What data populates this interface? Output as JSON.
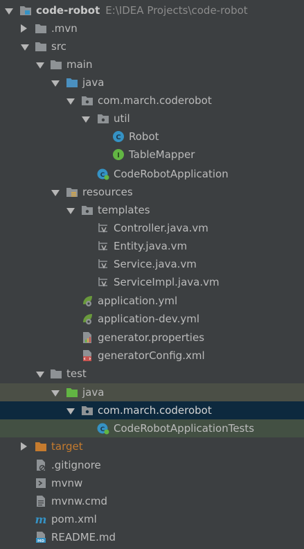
{
  "project": {
    "name": "code-robot",
    "path": "E:\\IDEA Projects\\code-robot"
  },
  "items": [
    {
      "label": ".mvn"
    },
    {
      "label": "src"
    },
    {
      "label": "main"
    },
    {
      "label": "java"
    },
    {
      "label": "com.march.coderobot"
    },
    {
      "label": "util"
    },
    {
      "label": "Robot"
    },
    {
      "label": "TableMapper"
    },
    {
      "label": "CodeRobotApplication"
    },
    {
      "label": "resources"
    },
    {
      "label": "templates"
    },
    {
      "label": "Controller.java.vm"
    },
    {
      "label": "Entity.java.vm"
    },
    {
      "label": "Service.java.vm"
    },
    {
      "label": "ServiceImpl.java.vm"
    },
    {
      "label": "application.yml"
    },
    {
      "label": "application-dev.yml"
    },
    {
      "label": "generator.properties"
    },
    {
      "label": "generatorConfig.xml"
    },
    {
      "label": "test"
    },
    {
      "label": "java"
    },
    {
      "label": "com.march.coderobot"
    },
    {
      "label": "CodeRobotApplicationTests"
    },
    {
      "label": "target"
    },
    {
      "label": ".gitignore"
    },
    {
      "label": "mvnw"
    },
    {
      "label": "mvnw.cmd"
    },
    {
      "label": "pom.xml"
    },
    {
      "label": "README.md"
    }
  ],
  "colors": {
    "background": "#3c3f41",
    "folder": "#8e9295",
    "source_folder": "#4a90c0",
    "test_folder": "#62b543",
    "excluded_folder": "#c57b2e",
    "selection": "#0d293e"
  }
}
